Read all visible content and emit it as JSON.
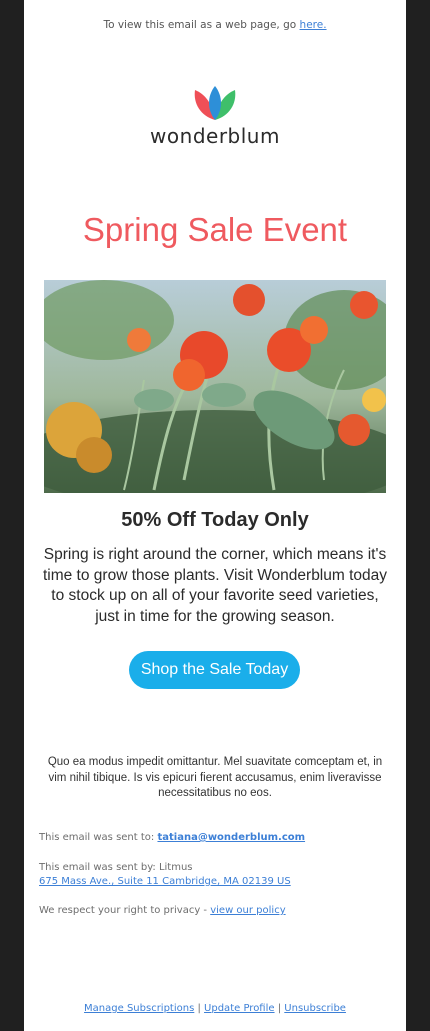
{
  "preheader": {
    "text": "To view this email as a web page, go",
    "link": "here."
  },
  "brand": {
    "name": "wonderblum",
    "colors": {
      "petal_red": "#ef4f57",
      "petal_blue": "#2d8fd8",
      "petal_green": "#3fbf6a"
    }
  },
  "headline": "Spring Sale Event",
  "hero": {
    "alt": "flowers-photo"
  },
  "offer": {
    "title": "50% Off Today Only",
    "body": "Spring is right around the corner, which means it's time to grow those plants. Visit Wonderblum today to stock up on all of your favorite seed varieties, just in time for the growing season.",
    "cta": "Shop the Sale Today"
  },
  "latin": "Quo ea modus impedit omittantur. Mel suavitate comceptam et, in vim nihil tibique. Is vis epicuri fierent accusamus, enim liveravisse necessitatibus no eos.",
  "footer": {
    "sent_to_label": "This email was sent to:",
    "sent_to_email": "tatiana@wonderblum.com",
    "sent_by": "This email was sent by: Litmus",
    "address": "675 Mass Ave., Suite 11 Cambridge, MA 02139 US",
    "privacy_text": "We respect your right to privacy -",
    "privacy_link": "view our policy",
    "links": [
      "Manage Subscriptions",
      "Update Profile",
      "Unsubscribe"
    ],
    "separator": "|"
  },
  "colors": {
    "accent": "#ef5a5f",
    "button": "#1aaeea",
    "link": "#3c7fd6"
  }
}
